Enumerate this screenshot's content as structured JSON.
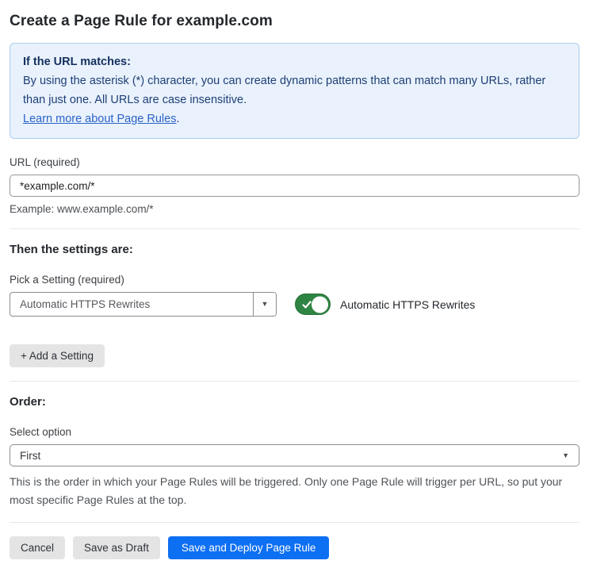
{
  "page": {
    "title": "Create a Page Rule for example.com"
  },
  "info_box": {
    "heading": "If the URL matches:",
    "body": "By using the asterisk (*) character, you can create dynamic patterns that can match many URLs, rather than just one. All URLs are case insensitive.",
    "link_label": "Learn more about Page Rules",
    "link_suffix": "."
  },
  "url_field": {
    "label": "URL (required)",
    "value": "*example.com/*",
    "helper": "Example: www.example.com/*"
  },
  "settings": {
    "heading": "Then the settings are:",
    "pick_label": "Pick a Setting (required)",
    "selected_setting": "Automatic HTTPS Rewrites",
    "toggle_state": "on",
    "toggle_label": "Automatic HTTPS Rewrites",
    "add_button_label": "+ Add a Setting",
    "dropdown_arrow": "▼"
  },
  "order": {
    "heading": "Order:",
    "select_label": "Select option",
    "selected_option": "First",
    "dropdown_arrow": "▼",
    "helper": "This is the order in which your Page Rules will be triggered. Only one Page Rule will trigger per URL, so put your most specific Page Rules at the top."
  },
  "actions": {
    "cancel_label": "Cancel",
    "save_draft_label": "Save as Draft",
    "save_deploy_label": "Save and Deploy Page Rule"
  },
  "colors": {
    "info_bg": "#e9f2fc",
    "info_border": "#abcdf0",
    "info_text": "#1e3e77",
    "link": "#2b62c9",
    "toggle_on_green": "#2e8443",
    "primary_button_blue": "#0d6ff2",
    "secondary_button_gray": "#e4e4e4"
  }
}
